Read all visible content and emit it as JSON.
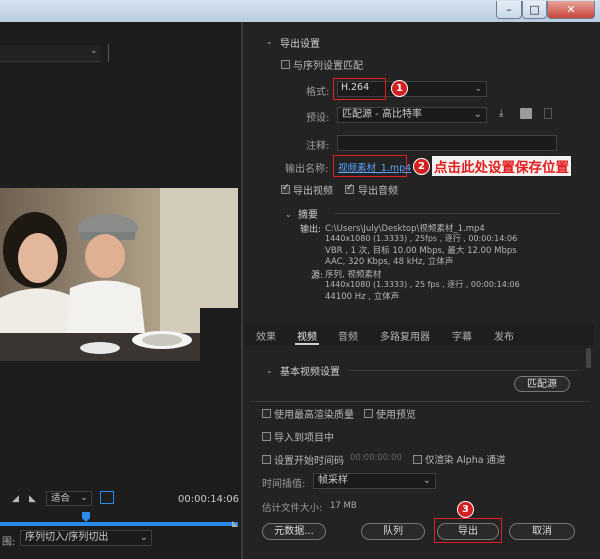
{
  "window": {
    "min": "–",
    "max": "□",
    "close": "✕"
  },
  "left": {
    "timecode": "00:00:14:06",
    "fit_select": "适合",
    "source_range_label": "围:",
    "source_range_value": "序列切入/序列切出"
  },
  "export": {
    "section_title": "导出设置",
    "match_sequence": "与序列设置匹配",
    "format_label": "格式:",
    "format_value": "H.264",
    "preset_label": "预设:",
    "preset_value": "匹配源 - 高比特率",
    "comment_label": "注释:",
    "output_name_label": "输出名称:",
    "output_name_value": "视频素材_1.mp4",
    "export_video": "导出视频",
    "export_audio": "导出音频",
    "summary_title": "摘要",
    "output_label": "输出:",
    "output_lines": [
      "C:\\Users\\July\\Desktop\\视频素材_1.mp4",
      "1440x1080 (1.3333) , 25fps , 逐行 , 00:00:14:06",
      "VBR , 1 次, 目标 10.00 Mbps, 最大 12.00 Mbps",
      "AAC, 320 Kbps, 48  kHz, 立体声"
    ],
    "source_label": "源:",
    "source_lines": [
      "序列, 视频素材",
      "1440x1080 (1.3333) , 25 fps , 逐行 , 00:00:14:06",
      "44100 Hz , 立体声"
    ]
  },
  "annotations": {
    "badge1": "1",
    "badge2": "2",
    "badge3": "3",
    "note2": "点击此处设置保存位置"
  },
  "tabs": [
    "效果",
    "视频",
    "音频",
    "多路复用器",
    "字幕",
    "发布"
  ],
  "basic_video": {
    "title": "基本视频设置",
    "match_source": "匹配源"
  },
  "options": {
    "max_render": "使用最高渲染质量",
    "use_preview": "使用预览",
    "import_project": "导入到项目中",
    "set_start_timecode": "设置开始时间码",
    "start_timecode_value": "00:00:00:00",
    "render_alpha": "仅渲染 Alpha 通道",
    "time_interp_label": "时间插值:",
    "time_interp_value": "帧采样",
    "filesize_label": "估计文件大小:",
    "filesize_value": "17 MB"
  },
  "buttons": {
    "metadata": "元数据...",
    "queue": "队列",
    "export": "导出",
    "cancel": "取消"
  },
  "colors": {
    "accent": "#2d8ceb",
    "highlight": "#e02020",
    "link": "#5ba7ff"
  }
}
